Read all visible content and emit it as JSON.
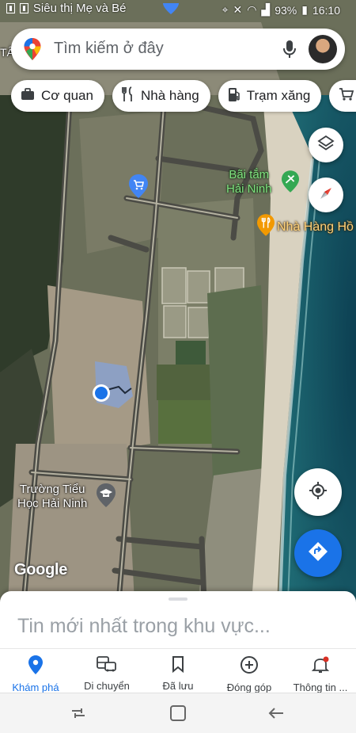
{
  "status_bar": {
    "top_label": "Siêu thị Mẹ và Bé",
    "battery": "93%",
    "time": "16:10"
  },
  "search": {
    "placeholder": "Tìm kiếm ở đây",
    "mic_icon": "mic-icon",
    "avatar_icon": "avatar"
  },
  "chips": [
    {
      "label": "Cơ quan",
      "icon": "briefcase-icon"
    },
    {
      "label": "Nhà hàng",
      "icon": "fork-knife-icon"
    },
    {
      "label": "Trạm xăng",
      "icon": "gas-station-icon"
    },
    {
      "label": "",
      "icon": "cart-icon"
    }
  ],
  "map": {
    "labels": {
      "edge_label": "TÂ",
      "beach": "Bãi tắm\nHải Ninh",
      "restaurant": "Nhà Hàng Hồ",
      "school": "Trường Tiểu\nHọc Hải Ninh",
      "google": "Google"
    },
    "colors": {
      "location_dot": "#1a73e8",
      "shopping_pin": "#4285f4",
      "park_pin": "#34a853",
      "restaurant_pin": "#f29900",
      "school_pin": "#5f6368"
    }
  },
  "buttons": {
    "layers": "layers-icon",
    "compass": "compass-icon",
    "my_location": "my-location-icon",
    "directions": "directions-icon"
  },
  "sheet": {
    "title": "Tin mới nhất trong khu vực..."
  },
  "bottom_nav": [
    {
      "label": "Khám phá",
      "icon": "explore-pin-icon",
      "active": true
    },
    {
      "label": "Di chuyển",
      "icon": "commute-icon",
      "active": false
    },
    {
      "label": "Đã lưu",
      "icon": "bookmark-icon",
      "active": false
    },
    {
      "label": "Đóng góp",
      "icon": "add-circle-icon",
      "active": false
    },
    {
      "label": "Thông tin ...",
      "icon": "bell-icon",
      "active": false
    }
  ]
}
